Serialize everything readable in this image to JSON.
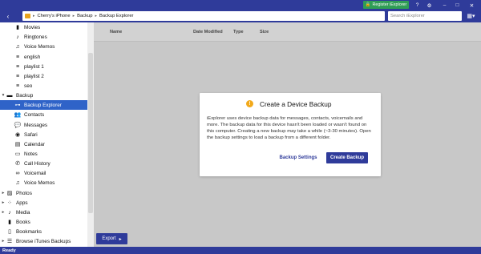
{
  "title_bar": {
    "register_label": "Register iExplorer"
  },
  "toolbar": {
    "breadcrumbs": [
      "Cherry's iPhone",
      "Backup",
      "Backup Explorer"
    ],
    "search_placeholder": "Search iExplorer"
  },
  "sidebar": {
    "items": [
      {
        "label": "Movies",
        "icon": "film-icon"
      },
      {
        "label": "Ringtones",
        "icon": "bell-icon"
      },
      {
        "label": "Voice Memos",
        "icon": "voice-icon"
      },
      {
        "label": "english",
        "icon": "playlist-icon"
      },
      {
        "label": "playlist 1",
        "icon": "playlist-icon"
      },
      {
        "label": "playlist 2",
        "icon": "playlist-icon"
      },
      {
        "label": "seo",
        "icon": "playlist-icon"
      },
      {
        "label": "Backup",
        "icon": "backup-icon"
      },
      {
        "label": "Backup Explorer",
        "icon": "tree-icon"
      },
      {
        "label": "Contacts",
        "icon": "contacts-icon"
      },
      {
        "label": "Messages",
        "icon": "messages-icon"
      },
      {
        "label": "Safari",
        "icon": "safari-icon"
      },
      {
        "label": "Calendar",
        "icon": "calendar-icon"
      },
      {
        "label": "Notes",
        "icon": "notes-icon"
      },
      {
        "label": "Call History",
        "icon": "phone-icon"
      },
      {
        "label": "Voicemail",
        "icon": "voicemail-icon"
      },
      {
        "label": "Voice Memos",
        "icon": "voice-icon"
      },
      {
        "label": "Photos",
        "icon": "photos-icon"
      },
      {
        "label": "Apps",
        "icon": "apps-icon"
      },
      {
        "label": "Media",
        "icon": "media-icon"
      },
      {
        "label": "Books",
        "icon": "books-icon"
      },
      {
        "label": "Bookmarks",
        "icon": "bookmark-icon"
      },
      {
        "label": "Browse iTunes Backups",
        "icon": "backups-icon"
      }
    ]
  },
  "table": {
    "columns": [
      "Name",
      "Date Modified",
      "Type",
      "Size"
    ]
  },
  "dialog": {
    "title": "Create a Device Backup",
    "body": "iExplorer uses device backup data for messages, contacts, voicemails and more. The backup data for this device hasn't been loaded or wasn't found on this computer. Creating a new backup may take a while (~3-30 minutes). Open the backup settings to load a backup from a different folder.",
    "settings_label": "Backup Settings",
    "create_label": "Create Backup"
  },
  "footer": {
    "export_label": "Export"
  },
  "status": {
    "text": "Ready"
  },
  "colors": {
    "primary": "#2f3b9a",
    "selection": "#2f63c8",
    "register": "#2f9d55",
    "warning": "#f2a91a"
  }
}
